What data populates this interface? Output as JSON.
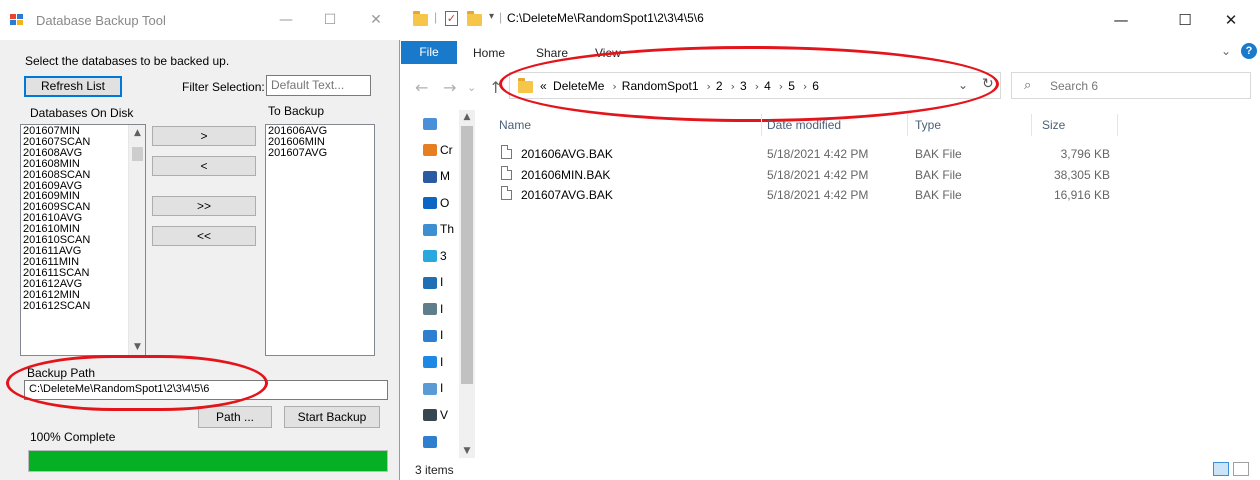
{
  "backup_tool": {
    "title": "Database Backup Tool",
    "window_controls": {
      "minimize": "—",
      "maximize": "☐",
      "close": "✕"
    },
    "instruction": "Select the databases to be backed up.",
    "refresh_button": "Refresh List",
    "filter_label": "Filter Selection:",
    "filter_placeholder": "Default Text...",
    "disk_header": "Databases On Disk",
    "backup_header": "To Backup",
    "disk_items": [
      "201607MIN",
      "201607SCAN",
      "201608AVG",
      "201608MIN",
      "201608SCAN",
      "201609AVG",
      "201609MIN",
      "201609SCAN",
      "201610AVG",
      "201610MIN",
      "201610SCAN",
      "201611AVG",
      "201611MIN",
      "201611SCAN",
      "201612AVG",
      "201612MIN",
      "201612SCAN"
    ],
    "backup_items": [
      "201606AVG",
      "201606MIN",
      "201607AVG"
    ],
    "move_buttons": {
      "add": ">",
      "remove": "<",
      "add_all": ">>",
      "remove_all": "<<"
    },
    "path_label": "Backup Path",
    "path_value": "C:\\DeleteMe\\RandomSpot1\\2\\3\\4\\5\\6",
    "path_button": "Path ...",
    "start_button": "Start Backup",
    "progress_text": "100% Complete",
    "progress_fraction": 1.0,
    "progress_color": "#06b025"
  },
  "explorer": {
    "title_path": "C:\\DeleteMe\\RandomSpot1\\2\\3\\4\\5\\6",
    "window_controls": {
      "minimize": "—",
      "maximize": "☐",
      "close": "✕"
    },
    "ribbon": {
      "file": "File",
      "home": "Home",
      "share": "Share",
      "view": "View"
    },
    "breadcrumb_overflow": "«",
    "breadcrumbs": [
      "DeleteMe",
      "RandomSpot1",
      "2",
      "3",
      "4",
      "5",
      "6"
    ],
    "search_placeholder": "Search 6",
    "nav_items": [
      {
        "icon": "quick-access-icon",
        "label": ""
      },
      {
        "icon": "onedrive-folder-icon",
        "label": "Cr"
      },
      {
        "icon": "office-icon",
        "label": "M"
      },
      {
        "icon": "cloud-icon",
        "label": "O"
      },
      {
        "icon": "this-pc-icon",
        "label": "Th"
      },
      {
        "icon": "3d-objects-icon",
        "label": "3"
      },
      {
        "icon": "desktop-icon",
        "label": "I"
      },
      {
        "icon": "documents-icon",
        "label": "I"
      },
      {
        "icon": "downloads-icon",
        "label": "I"
      },
      {
        "icon": "music-icon",
        "label": "I"
      },
      {
        "icon": "pictures-icon",
        "label": "I"
      },
      {
        "icon": "videos-icon",
        "label": "V"
      },
      {
        "icon": "drive-icon",
        "label": ""
      }
    ],
    "columns": {
      "name": "Name",
      "date": "Date modified",
      "type": "Type",
      "size": "Size"
    },
    "files": [
      {
        "name": "201606AVG.BAK",
        "date": "5/18/2021 4:42 PM",
        "type": "BAK File",
        "size": "3,796 KB"
      },
      {
        "name": "201606MIN.BAK",
        "date": "5/18/2021 4:42 PM",
        "type": "BAK File",
        "size": "38,305 KB"
      },
      {
        "name": "201607AVG.BAK",
        "date": "5/18/2021 4:42 PM",
        "type": "BAK File",
        "size": "16,916 KB"
      }
    ],
    "status": "3 items",
    "accent_color": "#1979ca",
    "annotation_color": "#e3141a"
  }
}
